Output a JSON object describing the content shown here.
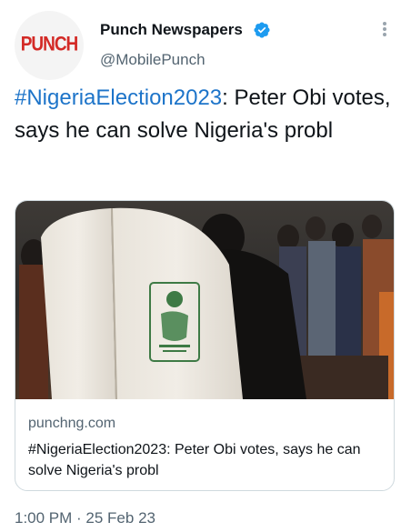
{
  "author": {
    "name": "Punch Newspapers",
    "handle": "@MobilePunch",
    "avatar_logo": "PUNCH",
    "verified_icon": "verified-badge-icon"
  },
  "tweet": {
    "hashtag": "#NigeriaElection2023",
    "text_rest": ": Peter Obi votes, says he can solve Nigeria's probl"
  },
  "card": {
    "image_icon": "news-photo-voting-booth",
    "domain": "punchng.com",
    "title": "#NigeriaElection2023: Peter Obi votes, says he can solve Nigeria's probl"
  },
  "timestamp": "1:00 PM · 25 Feb 23",
  "colors": {
    "link": "#1d74c9",
    "text": "#0f1419",
    "secondary": "#536471",
    "border": "#cfd9de",
    "verified": "#1d9bf0",
    "brand": "#d32a26"
  },
  "more_icon": "more-vertical-icon"
}
